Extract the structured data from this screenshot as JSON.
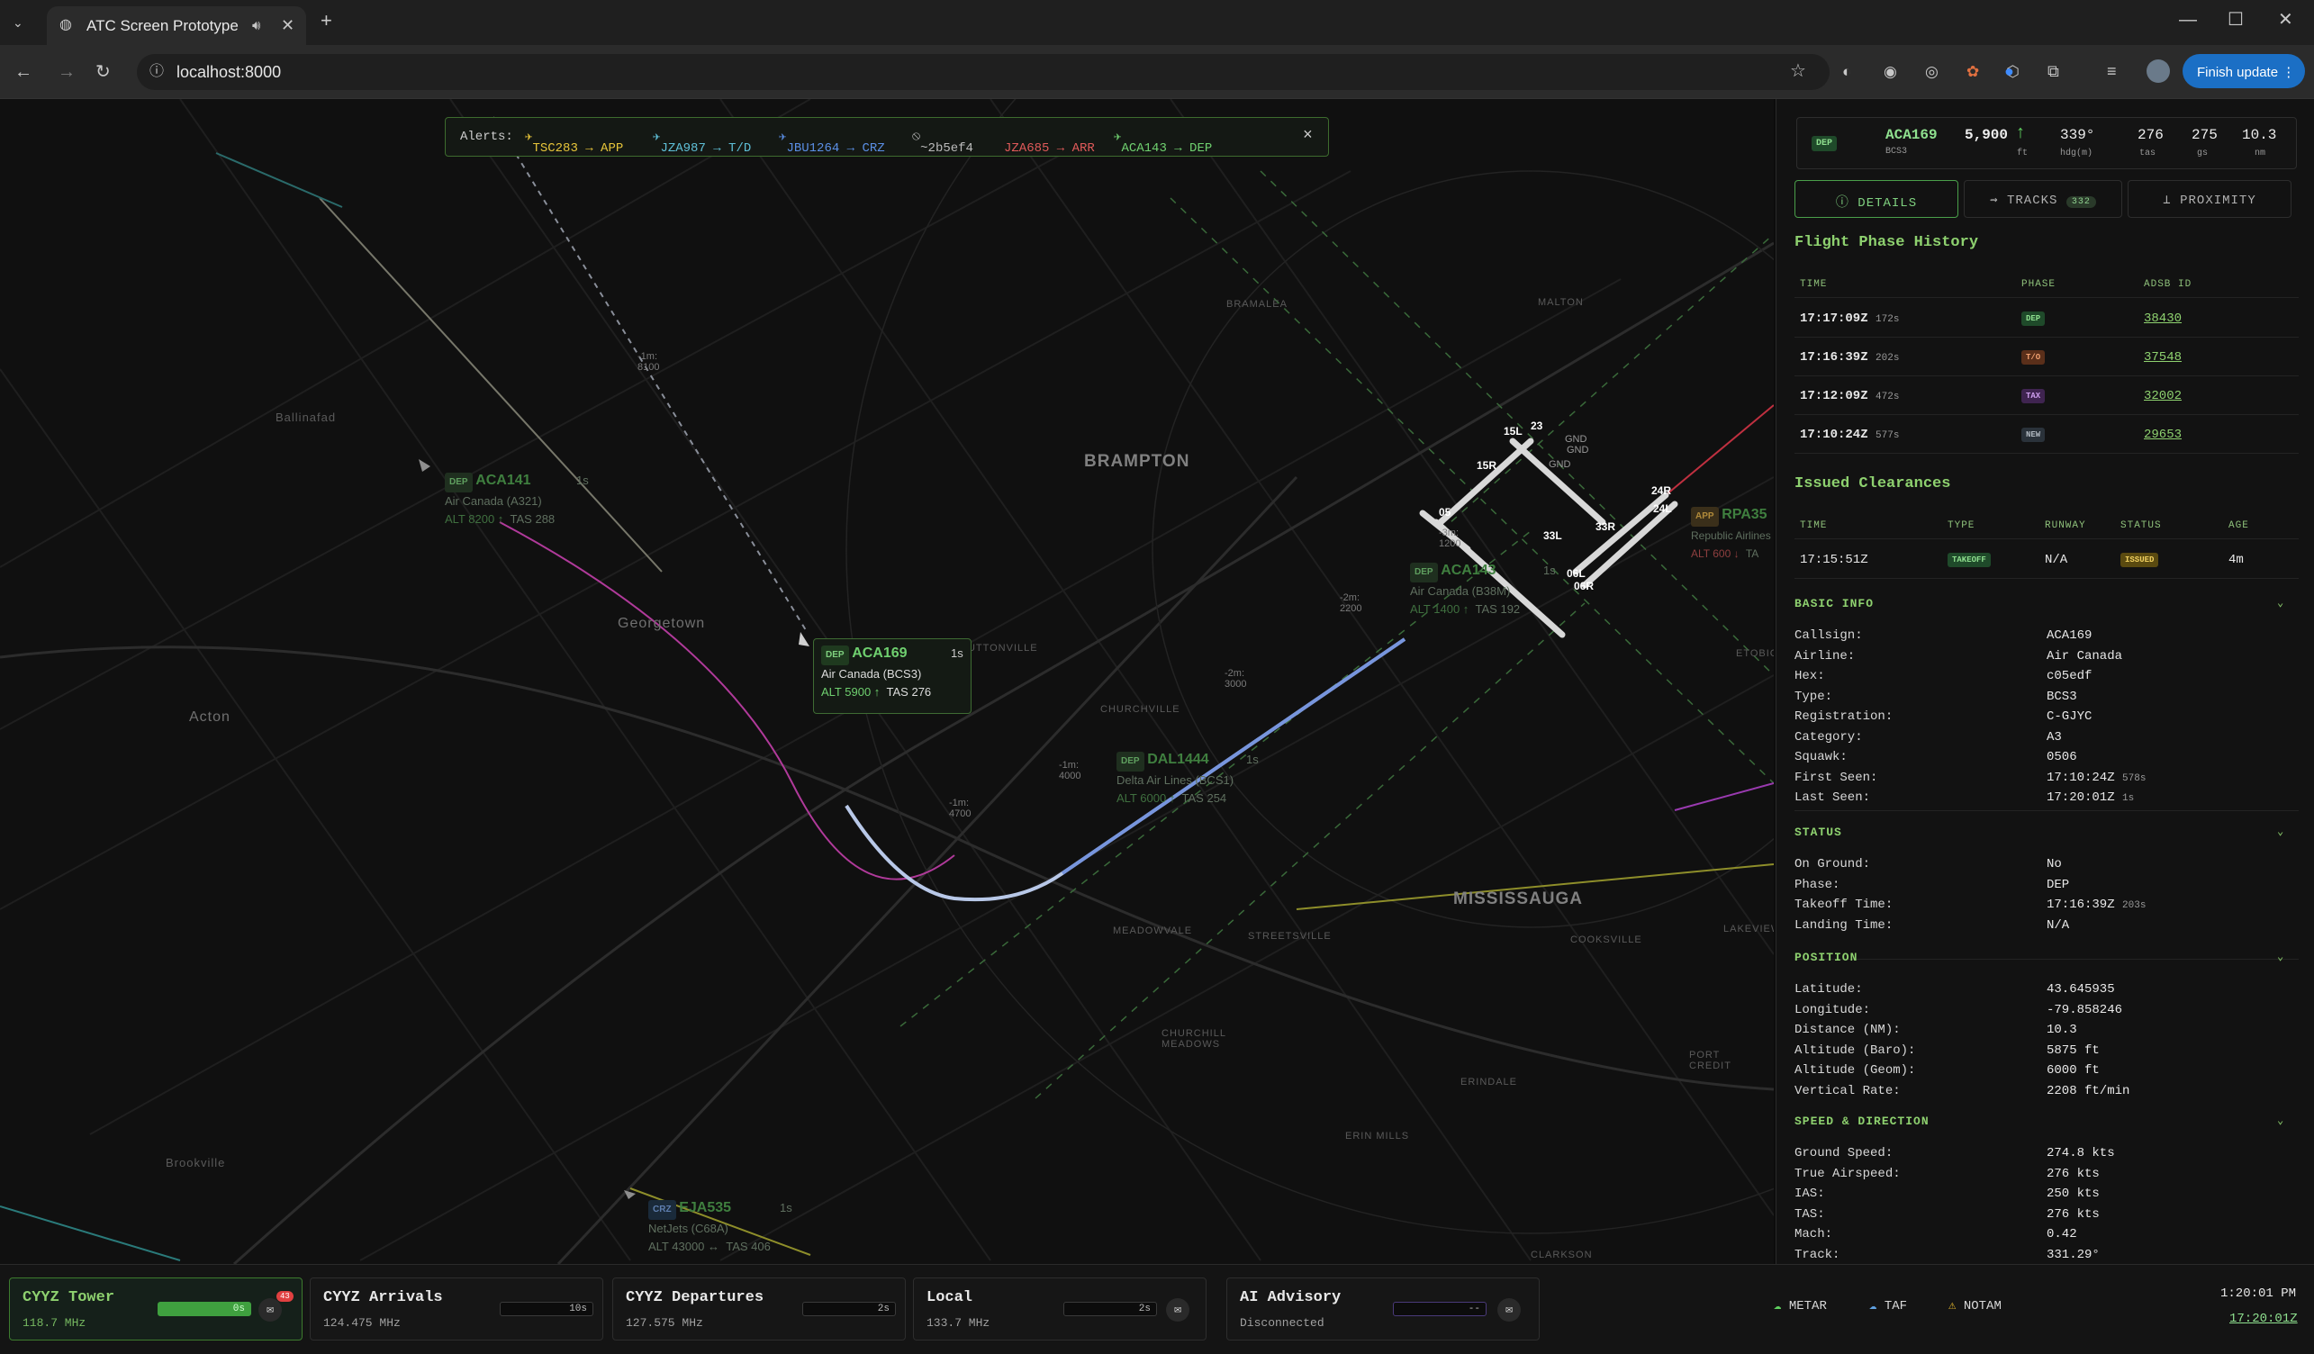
{
  "browser": {
    "tab_title": "ATC Screen Prototype",
    "url": "localhost:8000",
    "finish_update": "Finish update"
  },
  "alerts": {
    "label": "Alerts:",
    "items": [
      {
        "text": "TSC283 → APP",
        "color": "#e7c53a"
      },
      {
        "text": "JZA987 → T/D",
        "color": "#5fc0d8"
      },
      {
        "text": "JBU1264 → CRZ",
        "color": "#5b8fe6"
      },
      {
        "text": "~2b5ef4",
        "color": "#bbbbbb"
      },
      {
        "text": "JZA685 → ARR",
        "color": "#e05a5a"
      },
      {
        "text": "ACA143 → DEP",
        "color": "#6fd06f"
      }
    ],
    "close": "×"
  },
  "map": {
    "places": {
      "brampton": "BRAMPTON",
      "mississauga": "MISSISSAUGA",
      "georgetown": "Georgetown",
      "acton": "Acton",
      "ballinafad": "Ballinafad",
      "brookville": "Brookville",
      "bramalea": "BRAMALEA",
      "malton": "MALTON",
      "churchville": "CHURCHVILLE",
      "huttonville": "HUTTONVILLE",
      "meadowvale": "MEADOWVALE",
      "streetsville": "STREETSVILLE",
      "cooksville": "COOKSVILLE",
      "erindale": "ERINDALE",
      "churchill_meadows": "CHURCHILL MEADOWS",
      "erin_mills": "ERIN MILLS",
      "clarkson": "CLARKSON",
      "port_credit": "PORT CREDIT",
      "lakeview": "LAKEVIEW",
      "etobicoke": "ETOBICOKE"
    },
    "runways": [
      "15L",
      "23",
      "15R",
      "05",
      "33L",
      "33R",
      "24R",
      "24L",
      "06L",
      "06R"
    ],
    "ground_labels": [
      "GND",
      "GND",
      "GND"
    ],
    "track_marks": [
      "-1m: 8100",
      "-3m: 1200",
      "-2m: 2200",
      "-2m: 3000",
      "-1m: 4000",
      "-1m: 4700"
    ],
    "aircraft": [
      {
        "phase": "DEP",
        "callsign": "ACA141",
        "airline": "Air Canada (A321)",
        "alt": "ALT 8200 ↑",
        "tas": "TAS 288",
        "age": "1s"
      },
      {
        "phase": "DEP",
        "callsign": "ACA143",
        "airline": "Air Canada (B38M)",
        "alt": "ALT 1400 ↑",
        "tas": "TAS 192",
        "age": "1s"
      },
      {
        "phase": "DEP",
        "callsign": "DAL1444",
        "airline": "Delta Air Lines (BCS1)",
        "alt": "ALT 6000 ↑",
        "tas": "TAS 254",
        "age": "1s"
      },
      {
        "phase": "APP",
        "callsign": "RPA35",
        "airline": "Republic Airlines",
        "alt": "ALT 600 ↓",
        "tas": "TA",
        "age": ""
      },
      {
        "phase": "CRZ",
        "callsign": "EJA535",
        "airline": "NetJets (C68A)",
        "alt": "ALT 43000 ↔",
        "tas": "TAS 406",
        "age": "1s"
      }
    ],
    "selected": {
      "phase": "DEP",
      "callsign": "ACA169",
      "airline": "Air Canada (BCS3)",
      "alt": "ALT 5900 ↑",
      "tas": "TAS 276",
      "age": "1s"
    }
  },
  "sidebar": {
    "summary": {
      "phase": "DEP",
      "callsign": "ACA169",
      "type": "BCS3",
      "alt": "5,900",
      "alt_unit": "ft",
      "hdg": "339°",
      "hdg_unit": "hdg(m)",
      "tas": "276",
      "tas_unit": "tas",
      "gs": "275",
      "gs_unit": "gs",
      "nm": "10.3",
      "nm_unit": "nm"
    },
    "tabs": {
      "details": "DETAILS",
      "tracks": "TRACKS",
      "tracks_count": "332",
      "proximity": "PROXIMITY"
    },
    "phase_history": {
      "title": "Flight Phase History",
      "headers": [
        "TIME",
        "PHASE",
        "ADSB ID"
      ],
      "rows": [
        {
          "time": "17:17:09Z",
          "ago": "172s",
          "phase": "DEP",
          "color": "#2f7a3a",
          "id": "38430"
        },
        {
          "time": "17:16:39Z",
          "ago": "202s",
          "phase": "T/O",
          "color": "#a0552a",
          "id": "37548"
        },
        {
          "time": "17:12:09Z",
          "ago": "472s",
          "phase": "TAX",
          "color": "#6a3a8a",
          "id": "32002"
        },
        {
          "time": "17:10:24Z",
          "ago": "577s",
          "phase": "NEW",
          "color": "#3a4450",
          "id": "29653"
        }
      ]
    },
    "clearances": {
      "title": "Issued Clearances",
      "headers": [
        "TIME",
        "TYPE",
        "RUNWAY",
        "STATUS",
        "AGE"
      ],
      "row": {
        "time": "17:15:51Z",
        "type": "TAKEOFF",
        "runway": "N/A",
        "status": "ISSUED",
        "age": "4m"
      }
    },
    "basic_info": {
      "title": "BASIC INFO",
      "rows": [
        {
          "k": "Callsign:",
          "v": "ACA169",
          "s": ""
        },
        {
          "k": "Airline:",
          "v": "Air Canada",
          "s": ""
        },
        {
          "k": "Hex:",
          "v": "c05edf",
          "s": ""
        },
        {
          "k": "Type:",
          "v": "BCS3",
          "s": ""
        },
        {
          "k": "Registration:",
          "v": "C-GJYC",
          "s": ""
        },
        {
          "k": "Category:",
          "v": "A3",
          "s": ""
        },
        {
          "k": "Squawk:",
          "v": "0506",
          "s": ""
        },
        {
          "k": "First Seen:",
          "v": "17:10:24Z",
          "s": "578s"
        },
        {
          "k": "Last Seen:",
          "v": "17:20:01Z",
          "s": "1s"
        }
      ]
    },
    "status": {
      "title": "STATUS",
      "rows": [
        {
          "k": "On Ground:",
          "v": "No",
          "s": ""
        },
        {
          "k": "Phase:",
          "v": "DEP",
          "s": ""
        },
        {
          "k": "Takeoff Time:",
          "v": "17:16:39Z",
          "s": "203s"
        },
        {
          "k": "Landing Time:",
          "v": "N/A",
          "s": ""
        }
      ]
    },
    "position": {
      "title": "POSITION",
      "rows": [
        {
          "k": "Latitude:",
          "v": "43.645935",
          "s": ""
        },
        {
          "k": "Longitude:",
          "v": "-79.858246",
          "s": ""
        },
        {
          "k": "Distance (NM):",
          "v": "10.3",
          "s": ""
        },
        {
          "k": "Altitude (Baro):",
          "v": "5875 ft",
          "s": ""
        },
        {
          "k": "Altitude (Geom):",
          "v": "6000 ft",
          "s": ""
        },
        {
          "k": "Vertical Rate:",
          "v": "2208 ft/min",
          "s": ""
        }
      ]
    },
    "speed": {
      "title": "SPEED & DIRECTION",
      "rows": [
        {
          "k": "Ground Speed:",
          "v": "274.8 kts",
          "s": ""
        },
        {
          "k": "True Airspeed:",
          "v": "276 kts",
          "s": ""
        },
        {
          "k": "IAS:",
          "v": "250 kts",
          "s": ""
        },
        {
          "k": "TAS:",
          "v": "276 kts",
          "s": ""
        },
        {
          "k": "Mach:",
          "v": "0.42",
          "s": ""
        },
        {
          "k": "Track:",
          "v": "331.29°",
          "s": ""
        }
      ]
    }
  },
  "bottom": {
    "freqs": [
      {
        "name": "CYYZ Tower",
        "freq": "118.7 MHz",
        "timer": "0s",
        "badge": "43",
        "progress": 1.0
      },
      {
        "name": "CYYZ Arrivals",
        "freq": "124.475 MHz",
        "timer": "10s"
      },
      {
        "name": "CYYZ Departures",
        "freq": "127.575 MHz",
        "timer": "2s"
      },
      {
        "name": "Local",
        "freq": "133.7 MHz",
        "timer": "2s"
      },
      {
        "name": "AI Advisory",
        "freq": "Disconnected",
        "timer": "--"
      }
    ],
    "wx": {
      "metar": "METAR",
      "taf": "TAF",
      "notam": "NOTAM"
    },
    "clock_local": "1:20:01 PM",
    "clock_utc": "17:20:01Z"
  }
}
